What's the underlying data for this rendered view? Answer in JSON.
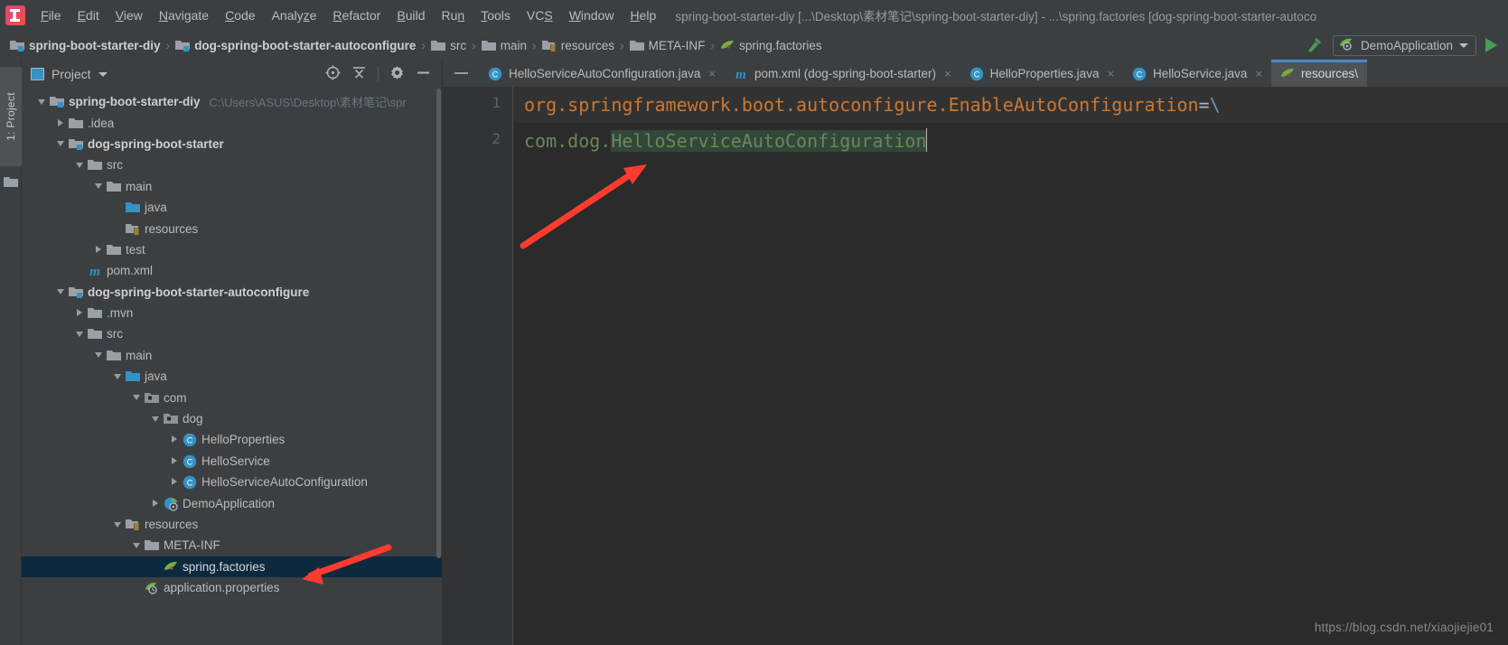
{
  "window": {
    "title": "spring-boot-starter-diy [...\\Desktop\\素材笔记\\spring-boot-starter-diy] - ...\\spring.factories [dog-spring-boot-starter-autoco",
    "logo_icon": "intellij-idea-logo"
  },
  "menubar": {
    "items": [
      {
        "pre": "",
        "u": "F",
        "post": "ile"
      },
      {
        "pre": "",
        "u": "E",
        "post": "dit"
      },
      {
        "pre": "",
        "u": "V",
        "post": "iew"
      },
      {
        "pre": "",
        "u": "N",
        "post": "avigate"
      },
      {
        "pre": "",
        "u": "C",
        "post": "ode"
      },
      {
        "pre": "Analy",
        "u": "z",
        "post": "e"
      },
      {
        "pre": "",
        "u": "R",
        "post": "efactor"
      },
      {
        "pre": "",
        "u": "B",
        "post": "uild"
      },
      {
        "pre": "Ru",
        "u": "n",
        "post": ""
      },
      {
        "pre": "",
        "u": "T",
        "post": "ools"
      },
      {
        "pre": "VC",
        "u": "S",
        "post": ""
      },
      {
        "pre": "",
        "u": "W",
        "post": "indow"
      },
      {
        "pre": "",
        "u": "H",
        "post": "elp"
      }
    ]
  },
  "navbar": {
    "crumbs": [
      {
        "label": "spring-boot-starter-diy",
        "icon": "module-folder-icon",
        "bold": true
      },
      {
        "label": "dog-spring-boot-starter-autoconfigure",
        "icon": "module-folder-icon",
        "bold": true
      },
      {
        "label": "src",
        "icon": "folder-icon",
        "bold": false
      },
      {
        "label": "main",
        "icon": "folder-icon",
        "bold": false
      },
      {
        "label": "resources",
        "icon": "resources-folder-icon",
        "bold": false
      },
      {
        "label": "META-INF",
        "icon": "folder-icon",
        "bold": false
      },
      {
        "label": "spring.factories",
        "icon": "spring-leaf-icon",
        "bold": false
      }
    ],
    "separator": "›",
    "hammer_icon": "build-hammer-icon",
    "run_config": {
      "label": "DemoApplication",
      "icon": "spring-boot-run-icon",
      "dropdown_icon": "chevron-down-icon"
    },
    "run_button_icon": "run-play-icon"
  },
  "tool_strip": {
    "project_tab": "1: Project",
    "folder_icon": "folder-icon"
  },
  "project_panel": {
    "title": "Project",
    "title_icon": "project-view-icon",
    "dropdown_icon": "chevron-down-icon",
    "buttons": [
      {
        "name": "locate-in-tree-icon"
      },
      {
        "name": "collapse-all-icon"
      },
      {
        "name": "settings-gear-icon"
      },
      {
        "name": "hide-panel-icon"
      }
    ],
    "tree": [
      {
        "indent": 0,
        "arrow": "open",
        "icon": "module-folder-icon",
        "label": "spring-boot-starter-diy",
        "bold": true,
        "hint": "C:\\Users\\ASUS\\Desktop\\素材笔记\\spr"
      },
      {
        "indent": 1,
        "arrow": "closed",
        "icon": "folder-icon",
        "label": ".idea",
        "bold": false,
        "hint": ""
      },
      {
        "indent": 1,
        "arrow": "open",
        "icon": "module-folder-icon",
        "label": "dog-spring-boot-starter",
        "bold": true,
        "hint": ""
      },
      {
        "indent": 2,
        "arrow": "open",
        "icon": "folder-icon",
        "label": "src",
        "bold": false,
        "hint": ""
      },
      {
        "indent": 3,
        "arrow": "open",
        "icon": "folder-icon",
        "label": "main",
        "bold": false,
        "hint": ""
      },
      {
        "indent": 4,
        "arrow": "none",
        "icon": "source-folder-icon",
        "label": "java",
        "bold": false,
        "hint": ""
      },
      {
        "indent": 4,
        "arrow": "none",
        "icon": "resources-folder-icon",
        "label": "resources",
        "bold": false,
        "hint": ""
      },
      {
        "indent": 3,
        "arrow": "closed",
        "icon": "folder-icon",
        "label": "test",
        "bold": false,
        "hint": ""
      },
      {
        "indent": 2,
        "arrow": "none",
        "icon": "maven-pom-icon",
        "label": "pom.xml",
        "bold": false,
        "hint": ""
      },
      {
        "indent": 1,
        "arrow": "open",
        "icon": "module-folder-icon",
        "label": "dog-spring-boot-starter-autoconfigure",
        "bold": true,
        "hint": ""
      },
      {
        "indent": 2,
        "arrow": "closed",
        "icon": "folder-icon",
        "label": ".mvn",
        "bold": false,
        "hint": ""
      },
      {
        "indent": 2,
        "arrow": "open",
        "icon": "folder-icon",
        "label": "src",
        "bold": false,
        "hint": ""
      },
      {
        "indent": 3,
        "arrow": "open",
        "icon": "folder-icon",
        "label": "main",
        "bold": false,
        "hint": ""
      },
      {
        "indent": 4,
        "arrow": "open",
        "icon": "source-folder-icon",
        "label": "java",
        "bold": false,
        "hint": ""
      },
      {
        "indent": 5,
        "arrow": "open",
        "icon": "package-icon",
        "label": "com",
        "bold": false,
        "hint": ""
      },
      {
        "indent": 6,
        "arrow": "open",
        "icon": "package-icon",
        "label": "dog",
        "bold": false,
        "hint": ""
      },
      {
        "indent": 7,
        "arrow": "closed",
        "icon": "java-class-icon",
        "label": "HelloProperties",
        "bold": false,
        "hint": ""
      },
      {
        "indent": 7,
        "arrow": "closed",
        "icon": "java-class-icon",
        "label": "HelloService",
        "bold": false,
        "hint": ""
      },
      {
        "indent": 7,
        "arrow": "closed",
        "icon": "java-class-icon",
        "label": "HelloServiceAutoConfiguration",
        "bold": false,
        "hint": ""
      },
      {
        "indent": 6,
        "arrow": "closed",
        "icon": "spring-boot-class-icon",
        "label": "DemoApplication",
        "bold": false,
        "hint": ""
      },
      {
        "indent": 4,
        "arrow": "open",
        "icon": "resources-folder-icon",
        "label": "resources",
        "bold": false,
        "hint": ""
      },
      {
        "indent": 5,
        "arrow": "open",
        "icon": "folder-icon",
        "label": "META-INF",
        "bold": false,
        "hint": ""
      },
      {
        "indent": 6,
        "arrow": "none",
        "icon": "spring-leaf-icon",
        "label": "spring.factories",
        "bold": false,
        "hint": "",
        "selected": true
      },
      {
        "indent": 5,
        "arrow": "none",
        "icon": "spring-config-icon",
        "label": "application.properties",
        "bold": false,
        "hint": ""
      }
    ]
  },
  "editor": {
    "minimize_icon": "minimize-tabs-icon",
    "tabs": [
      {
        "label": "HelloServiceAutoConfiguration.java",
        "icon": "java-class-icon",
        "close": "×",
        "active": false
      },
      {
        "label": "pom.xml (dog-spring-boot-starter)",
        "icon": "maven-pom-icon",
        "close": "×",
        "active": false
      },
      {
        "label": "HelloProperties.java",
        "icon": "java-class-icon",
        "close": "×",
        "active": false
      },
      {
        "label": "HelloService.java",
        "icon": "java-class-icon",
        "close": "×",
        "active": false
      },
      {
        "label": "resources\\",
        "icon": "spring-leaf-icon",
        "close": "",
        "active": true
      }
    ],
    "line_numbers": [
      "1",
      "2"
    ],
    "code": {
      "line1_key": "org.springframework.boot.autoconfigure.EnableAutoConfiguration",
      "line1_eq": "=",
      "line1_esc": "\\",
      "line2_prefix": "com.dog.",
      "line2_selected": "HelloServiceAutoConfiguration"
    }
  },
  "watermark": "https://blog.csdn.net/xiaojiejie01",
  "colors": {
    "chrome_bg": "#3C3F41",
    "editor_bg": "#2B2B2B",
    "gutter_bg": "#313335",
    "selection_bg": "#0D293E",
    "accent_blue": "#4A88C7",
    "keyword_orange": "#CC7832",
    "string_green": "#6A8759",
    "escape_blue": "#6897BB",
    "annotation_red": "#FF3B30",
    "run_green": "#499C54"
  }
}
